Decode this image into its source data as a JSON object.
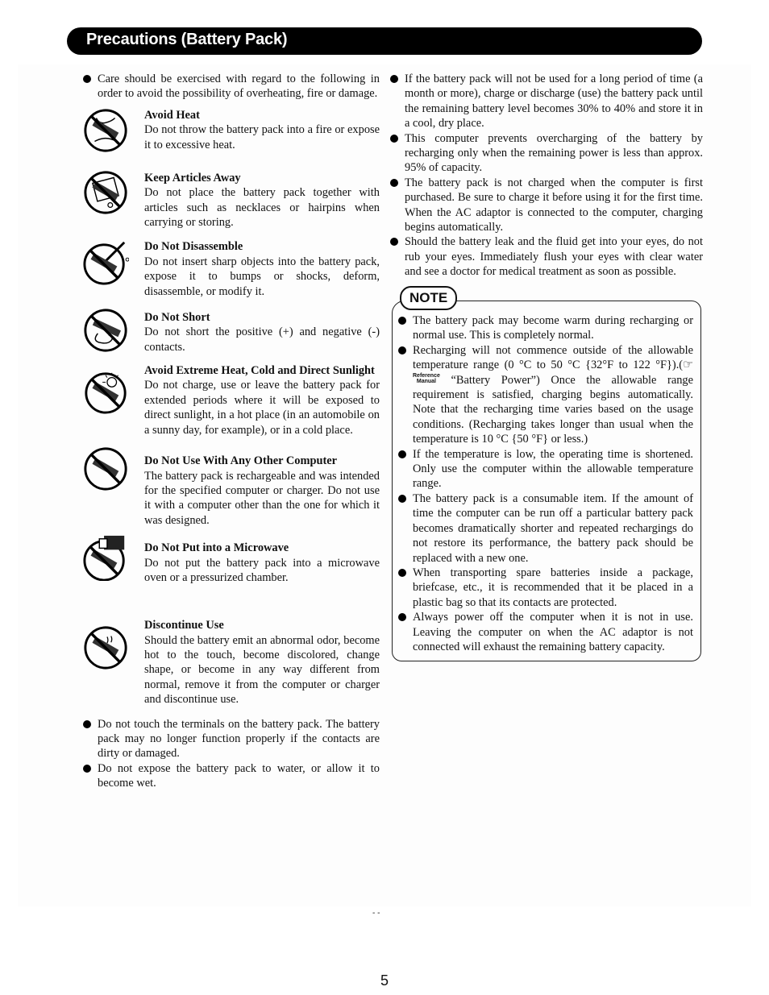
{
  "header": {
    "title": "Precautions (Battery Pack)"
  },
  "left_column": {
    "intro": "Care should be exercised with regard to the following in order to avoid the possibility of overheating, fire or damage.",
    "warnings": [
      {
        "icon": "no-fire-icon",
        "title": "Avoid Heat",
        "body": "Do not throw the battery pack into a fire or expose it to excessive heat."
      },
      {
        "icon": "no-metal-articles-icon",
        "title": "Keep Articles Away",
        "body": "Do not place the battery pack together with articles such as necklaces or hairpins when carrying or storing."
      },
      {
        "icon": "no-disassemble-icon",
        "title": "Do Not Disassemble",
        "body": "Do not insert sharp objects into the battery pack, expose it to bumps or shocks, deform, disassemble, or modify it."
      },
      {
        "icon": "no-short-circuit-icon",
        "title": "Do Not Short",
        "body": "Do not short the positive (+) and negative (-) contacts."
      },
      {
        "icon": "no-sunlight-icon",
        "title": "Avoid Extreme Heat, Cold and Direct Sunlight",
        "body": "Do not charge, use or leave the battery pack for extended periods where it will be exposed to direct sunlight, in a hot place (in an automobile on a sunny day, for example), or in a cold place."
      },
      {
        "icon": "no-other-computer-icon",
        "title": "Do Not Use With Any Other Computer",
        "body": "The battery pack is rechargeable and was intended for the specified computer or charger. Do not use it with a computer other than the one for which it was designed."
      },
      {
        "icon": "no-microwave-icon",
        "title": "Do Not Put into a Microwave",
        "body": "Do not put the battery pack into a microwave oven or a pressurized chamber."
      },
      {
        "icon": "discontinue-use-icon",
        "title": "Discontinue Use",
        "body": "Should the battery emit an abnormal odor, become hot to the touch, become discolored, change shape, or become in any way different from normal, remove it from the computer or charger and discontinue use."
      }
    ],
    "bullets": [
      "Do not touch the terminals on the battery pack.  The battery pack may no longer function properly if the contacts are dirty or damaged.",
      "Do not expose the battery pack to water, or allow it to become wet."
    ]
  },
  "right_column": {
    "bullets": [
      "If the battery pack will not be used for a long period of time (a month or more), charge or discharge (use) the battery pack until the remaining battery level becomes 30% to 40% and store it in a cool, dry place.",
      "This computer prevents overcharging of the battery by recharging only when the remaining power is less than approx. 95% of capacity.",
      "The battery pack is not charged when the computer is first purchased.  Be sure to charge it before using it for the first time.  When the AC adaptor is connected to the computer, charging begins automatically.",
      "Should the battery leak and the fluid get into your eyes, do not rub your eyes.  Immediately flush your eyes with clear water and see a doctor for medical treatment as soon as possible."
    ]
  },
  "note": {
    "label": "NOTE",
    "items": [
      {
        "text": "The battery pack may become warm during recharging or normal use.  This is completely normal."
      },
      {
        "text_before": "Recharging will not commence outside of the allowable temperature range (0 °C to 50 °C {32°F to 122 °F}).(",
        "pointer_glyph": "☞",
        "ref_top": "Reference",
        "ref_bottom": "Manual",
        "text_after": " “Battery Power”)  Once the allowable range requirement is satisfied, charging begins automatically. Note that the recharging time varies based on the usage conditions. (Recharging takes longer than usual when the temperature is 10 °C {50 °F} or less.)"
      },
      {
        "text": "If the temperature is low, the operating time is shortened. Only use the computer within the allowable temperature range."
      },
      {
        "text": "The battery pack is a consumable item.  If the amount of time the computer can be run off a particular battery pack becomes dramatically shorter and repeated rechargings do not restore its performance, the battery pack should be replaced with a new one."
      },
      {
        "text": "When transporting spare batteries inside a package, briefcase, etc., it is recommended that it be placed in a plastic bag so that its contacts are protected."
      },
      {
        "text": "Always power off the computer when it is not in use. Leaving the computer on when the AC adaptor is not connected will exhaust the remaining battery capacity."
      }
    ]
  },
  "footer": {
    "page_number": "5",
    "stray_marks": "- -"
  }
}
